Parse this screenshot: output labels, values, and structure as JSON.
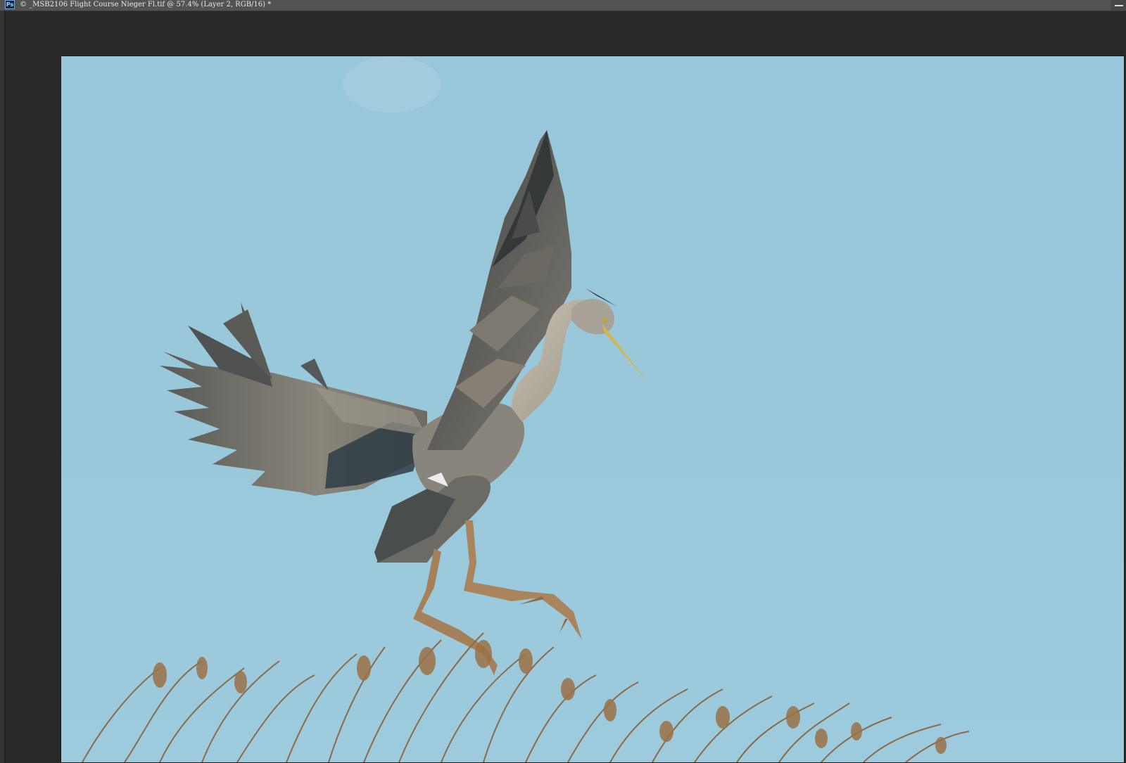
{
  "app": {
    "badge": "Ps",
    "document_tab_title": "© _MSB2106  Flight Course Nieger Fl.tif @ 57.4% (Layer 2, RGB/16) *"
  },
  "canvas": {
    "subject": "heron-landing-photo",
    "colors": {
      "sky": "#9bc9dc",
      "workspace": "#282828",
      "tabbar": "#535353"
    }
  },
  "icons": {
    "app": "photoshop-icon",
    "window": "minimize-icon"
  }
}
